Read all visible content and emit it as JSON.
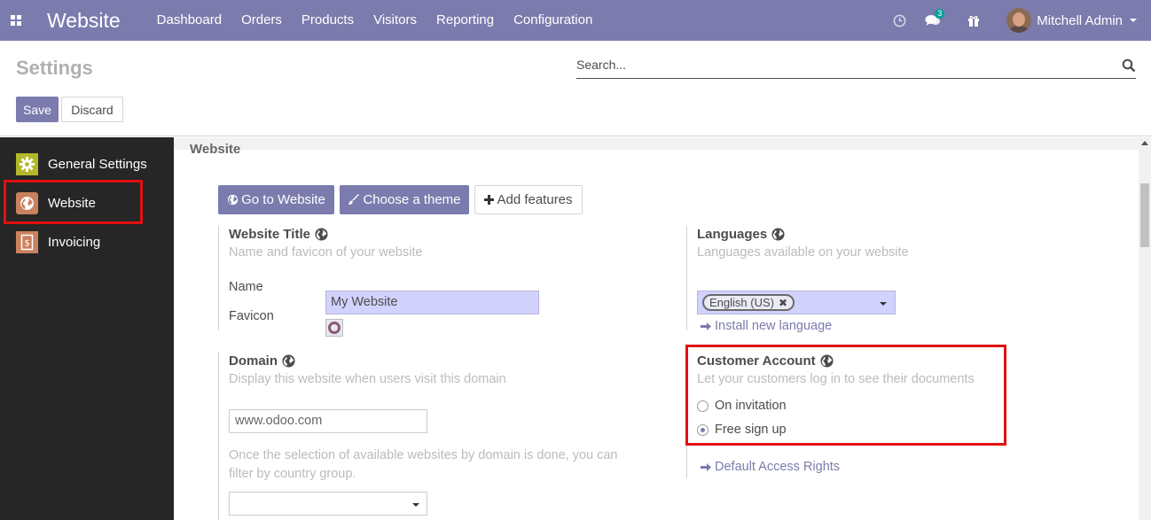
{
  "navbar": {
    "app_name": "Website",
    "menu": [
      "Dashboard",
      "Orders",
      "Products",
      "Visitors",
      "Reporting",
      "Configuration"
    ],
    "messages_count": "3",
    "user_name": "Mitchell Admin",
    "bg_color": "#7c7bad"
  },
  "control_panel": {
    "title": "Settings",
    "search_placeholder": "Search...",
    "save_label": "Save",
    "discard_label": "Discard"
  },
  "sidebar": {
    "items": [
      {
        "label": "General Settings",
        "icon": "gear-icon"
      },
      {
        "label": "Website",
        "icon": "globe-icon"
      },
      {
        "label": "Invoicing",
        "icon": "invoice-icon"
      }
    ]
  },
  "main": {
    "section_title": "Website",
    "actions": {
      "go_to_website": "Go to Website",
      "choose_theme": "Choose a theme",
      "add_features": "Add features"
    },
    "website_title": {
      "title": "Website Title",
      "description": "Name and favicon of your website",
      "name_label": "Name",
      "name_value": "My Website",
      "favicon_label": "Favicon"
    },
    "domain": {
      "title": "Domain",
      "description": "Display this website when users visit this domain",
      "placeholder": "www.odoo.com",
      "note": "Once the selection of available websites by domain is done, you can filter by country group."
    },
    "languages": {
      "title": "Languages",
      "description": "Languages available on your website",
      "selected_tag": "English (US)",
      "install_link": "Install new language"
    },
    "customer_account": {
      "title": "Customer Account",
      "description": "Let your customers log in to see their documents",
      "options": [
        "On invitation",
        "Free sign up"
      ],
      "selected": "Free sign up",
      "access_rights_link": "Default Access Rights"
    }
  },
  "colors": {
    "accent": "#7c7bad",
    "highlight": "#e01010",
    "sidebar_bg": "#262626"
  }
}
